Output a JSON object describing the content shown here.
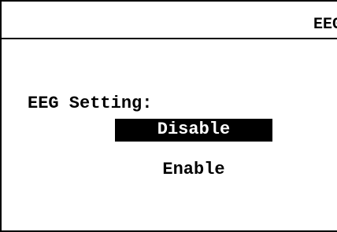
{
  "header": {
    "title": "EEG"
  },
  "setting": {
    "label": "EEG Setting:",
    "options": [
      {
        "label": "Disable",
        "selected": true
      },
      {
        "label": "Enable",
        "selected": false
      }
    ]
  },
  "colors": {
    "background": "#ffffff",
    "foreground": "#000000",
    "highlight_background": "#000000",
    "highlight_text": "#ffffff"
  }
}
